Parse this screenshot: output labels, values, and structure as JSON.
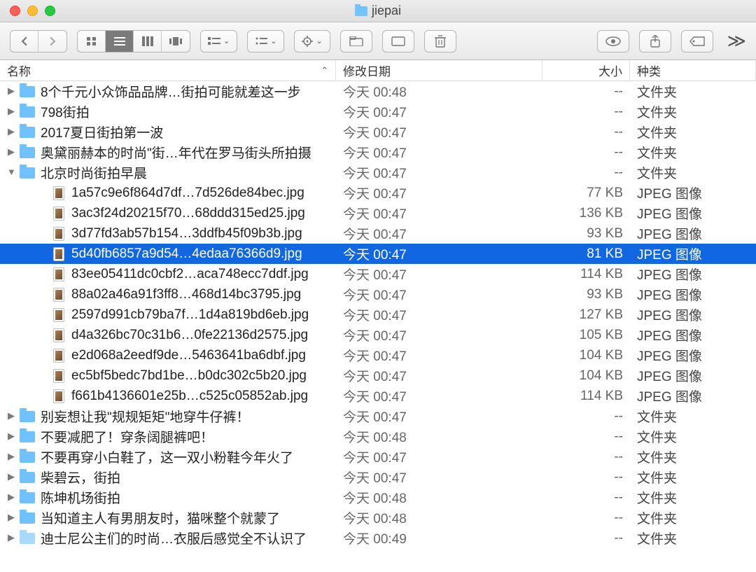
{
  "window_title": "jiepai",
  "columns": {
    "name": "名称",
    "date": "修改日期",
    "size": "大小",
    "kind": "种类"
  },
  "kinds": {
    "folder": "文件夹",
    "jpeg": "JPEG 图像"
  },
  "size_dash": "--",
  "rows": [
    {
      "type": "folder",
      "depth": 0,
      "expanded": false,
      "name": "8个千元小众饰品品牌…街拍可能就差这一步",
      "date": "今天 00:48",
      "size": "--",
      "kind": "folder"
    },
    {
      "type": "folder",
      "depth": 0,
      "expanded": false,
      "name": "798街拍",
      "date": "今天 00:47",
      "size": "--",
      "kind": "folder"
    },
    {
      "type": "folder",
      "depth": 0,
      "expanded": false,
      "name": "2017夏日街拍第一波",
      "date": "今天 00:47",
      "size": "--",
      "kind": "folder"
    },
    {
      "type": "folder",
      "depth": 0,
      "expanded": false,
      "name": "奥黛丽赫本的时尚\"街…年代在罗马街头所拍摄",
      "date": "今天 00:47",
      "size": "--",
      "kind": "folder"
    },
    {
      "type": "folder",
      "depth": 0,
      "expanded": true,
      "name": "北京时尚街拍早晨",
      "date": "今天 00:47",
      "size": "--",
      "kind": "folder"
    },
    {
      "type": "file",
      "depth": 1,
      "name": "1a57c9e6f864d7df…7d526de84bec.jpg",
      "date": "今天 00:47",
      "size": "77 KB",
      "kind": "jpeg"
    },
    {
      "type": "file",
      "depth": 1,
      "name": "3ac3f24d20215f70…68ddd315ed25.jpg",
      "date": "今天 00:47",
      "size": "136 KB",
      "kind": "jpeg"
    },
    {
      "type": "file",
      "depth": 1,
      "name": "3d77fd3ab57b154…3ddfb45f09b3b.jpg",
      "date": "今天 00:47",
      "size": "93 KB",
      "kind": "jpeg"
    },
    {
      "type": "file",
      "depth": 1,
      "name": "5d40fb6857a9d54…4edaa76366d9.jpg",
      "date": "今天 00:47",
      "size": "81 KB",
      "kind": "jpeg",
      "selected": true
    },
    {
      "type": "file",
      "depth": 1,
      "name": "83ee05411dc0cbf2…aca748ecc7ddf.jpg",
      "date": "今天 00:47",
      "size": "114 KB",
      "kind": "jpeg"
    },
    {
      "type": "file",
      "depth": 1,
      "name": "88a02a46a91f3ff8…468d14bc3795.jpg",
      "date": "今天 00:47",
      "size": "93 KB",
      "kind": "jpeg"
    },
    {
      "type": "file",
      "depth": 1,
      "name": "2597d991cb79ba7f…1d4a819bd6eb.jpg",
      "date": "今天 00:47",
      "size": "127 KB",
      "kind": "jpeg"
    },
    {
      "type": "file",
      "depth": 1,
      "name": "d4a326bc70c31b6…0fe22136d2575.jpg",
      "date": "今天 00:47",
      "size": "105 KB",
      "kind": "jpeg"
    },
    {
      "type": "file",
      "depth": 1,
      "name": "e2d068a2eedf9de…5463641ba6dbf.jpg",
      "date": "今天 00:47",
      "size": "104 KB",
      "kind": "jpeg"
    },
    {
      "type": "file",
      "depth": 1,
      "name": "ec5bf5bedc7bd1be…b0dc302c5b20.jpg",
      "date": "今天 00:47",
      "size": "104 KB",
      "kind": "jpeg"
    },
    {
      "type": "file",
      "depth": 1,
      "name": "f661b4136601e25b…c525c05852ab.jpg",
      "date": "今天 00:47",
      "size": "114 KB",
      "kind": "jpeg"
    },
    {
      "type": "folder",
      "depth": 0,
      "expanded": false,
      "name": "别妄想让我\"规规矩矩\"地穿牛仔裤！",
      "date": "今天 00:47",
      "size": "--",
      "kind": "folder"
    },
    {
      "type": "folder",
      "depth": 0,
      "expanded": false,
      "name": "不要减肥了！穿条阔腿裤吧！",
      "date": "今天 00:48",
      "size": "--",
      "kind": "folder"
    },
    {
      "type": "folder",
      "depth": 0,
      "expanded": false,
      "name": "不要再穿小白鞋了，这一双小粉鞋今年火了",
      "date": "今天 00:47",
      "size": "--",
      "kind": "folder"
    },
    {
      "type": "folder",
      "depth": 0,
      "expanded": false,
      "name": "柴碧云，街拍",
      "date": "今天 00:47",
      "size": "--",
      "kind": "folder"
    },
    {
      "type": "folder",
      "depth": 0,
      "expanded": false,
      "name": "陈坤机场街拍",
      "date": "今天 00:48",
      "size": "--",
      "kind": "folder"
    },
    {
      "type": "folder",
      "depth": 0,
      "expanded": false,
      "name": "当知道主人有男朋友时，猫咪整个就蒙了",
      "date": "今天 00:48",
      "size": "--",
      "kind": "folder"
    },
    {
      "type": "folder",
      "depth": 0,
      "expanded": false,
      "faded": true,
      "name": "迪士尼公主们的时尚…衣服后感觉全不认识了",
      "date": "今天 00:49",
      "size": "--",
      "kind": "folder"
    }
  ]
}
